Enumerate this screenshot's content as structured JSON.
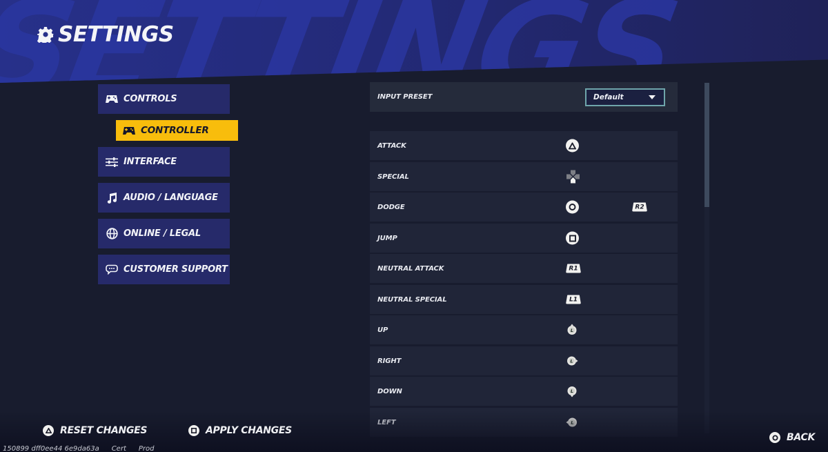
{
  "header": {
    "title": "SETTINGS",
    "title_icon": "gear-icon",
    "background_text": "SETTINGS"
  },
  "sidebar": {
    "items": [
      {
        "label": "CONTROLS",
        "icon": "gamepad-icon",
        "active": false
      },
      {
        "label": "CONTROLLER",
        "icon": "gamepad-icon",
        "active": true,
        "sub": true
      },
      {
        "label": "INTERFACE",
        "icon": "sliders-icon",
        "active": false
      },
      {
        "label": "AUDIO / LANGUAGE",
        "icon": "music-note-icon",
        "active": false
      },
      {
        "label": "ONLINE / LEGAL",
        "icon": "globe-icon",
        "active": false
      },
      {
        "label": "CUSTOMER SUPPORT",
        "icon": "chat-bubble-icon",
        "active": false
      }
    ]
  },
  "preset": {
    "label": "INPUT PRESET",
    "value": "Default"
  },
  "bindings": [
    {
      "action": "ATTACK",
      "primary": "triangle",
      "secondary": null
    },
    {
      "action": "SPECIAL",
      "primary": "dpad-down",
      "secondary": null
    },
    {
      "action": "DODGE",
      "primary": "circle",
      "secondary": "R2"
    },
    {
      "action": "JUMP",
      "primary": "square",
      "secondary": null
    },
    {
      "action": "NEUTRAL ATTACK",
      "primary": "R1",
      "secondary": null
    },
    {
      "action": "NEUTRAL SPECIAL",
      "primary": "L1",
      "secondary": null
    },
    {
      "action": "UP",
      "primary": "L-stick-up",
      "secondary": null
    },
    {
      "action": "RIGHT",
      "primary": "L-stick-right",
      "secondary": null
    },
    {
      "action": "DOWN",
      "primary": "L-stick-down",
      "secondary": null
    },
    {
      "action": "LEFT",
      "primary": "L-stick-left",
      "secondary": null
    }
  ],
  "footer": {
    "reset_label": "RESET CHANGES",
    "reset_icon": "triangle",
    "apply_label": "APPLY CHANGES",
    "apply_icon": "square",
    "back_label": "BACK",
    "back_icon": "circle",
    "build": [
      "150899 dff0ee44 6e9da63a",
      "Cert",
      "Prod"
    ]
  },
  "colors": {
    "accent_yellow": "#f8bd0c",
    "nav_bg": "#262a6a",
    "banner_blue": "#27308a",
    "dropdown_border": "#6fa6ab"
  }
}
